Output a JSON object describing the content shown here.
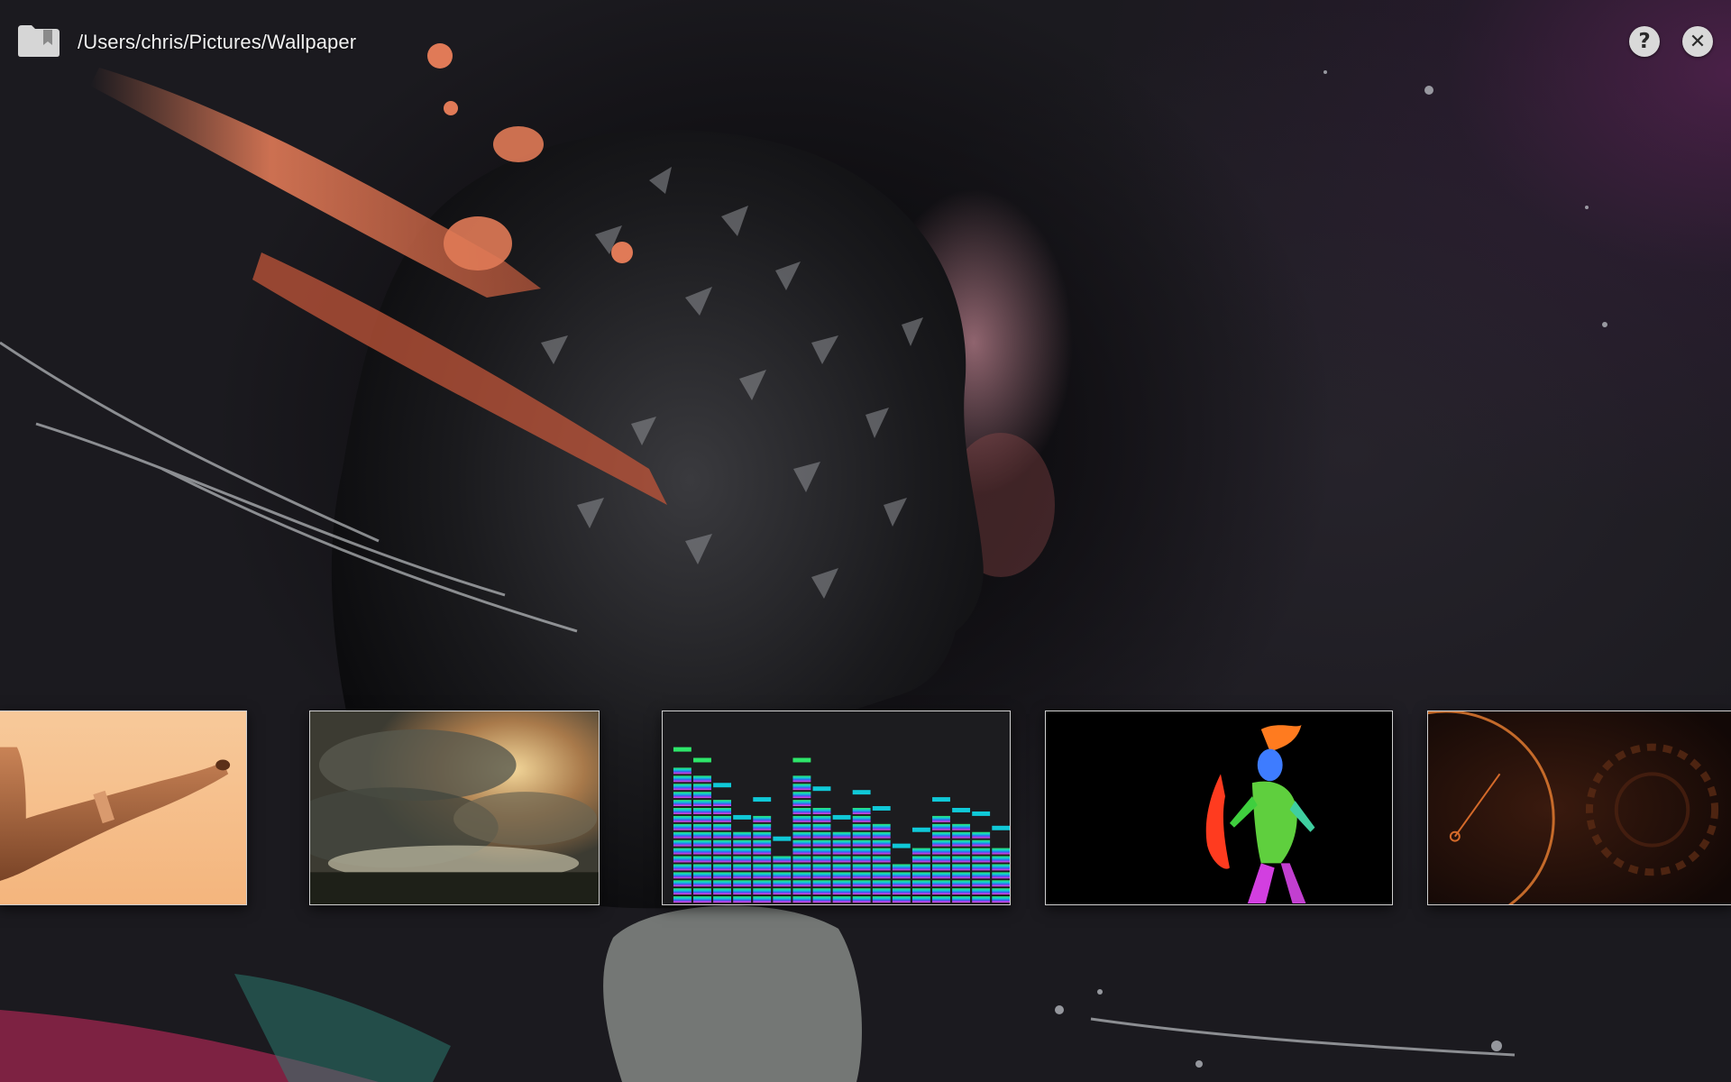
{
  "header": {
    "path": "/Users/chris/Pictures/Wallpaper",
    "folder_icon": "folder-bookmark-icon",
    "help_symbol": "?",
    "close_symbol": "✕"
  },
  "wallpaper": {
    "accent_orange": "#e07a57",
    "background": "#1c1b20"
  },
  "thumbnails": [
    {
      "subject": "pipe"
    },
    {
      "subject": "storm-battle"
    },
    {
      "subject": "equalizer-bars"
    },
    {
      "subject": "neon-warrior"
    },
    {
      "subject": "clock-gears"
    }
  ]
}
